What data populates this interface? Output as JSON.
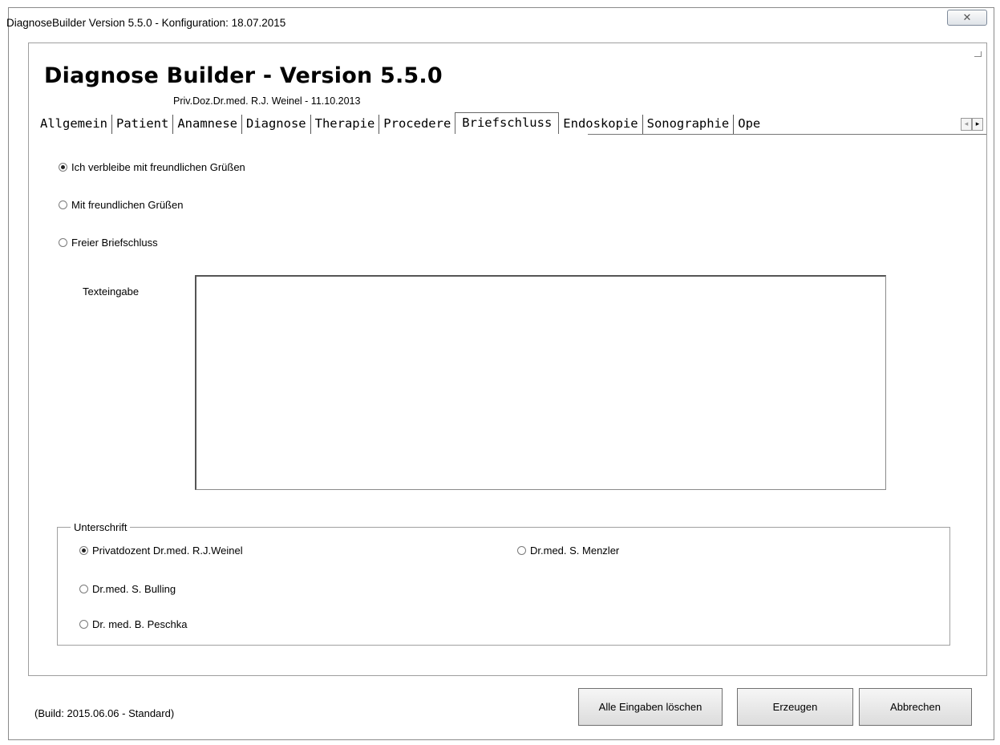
{
  "window": {
    "title": "DiagnoseBuilder Version 5.5.0 - Konfiguration: 18.07.2015",
    "close_glyph": "✕"
  },
  "header": {
    "title": "Diagnose Builder - Version 5.5.0",
    "subtitle": "Priv.Doz.Dr.med. R.J. Weinel - 11.10.2013"
  },
  "tabs": [
    {
      "label": "Allgemein",
      "active": false
    },
    {
      "label": "Patient",
      "active": false
    },
    {
      "label": "Anamnese",
      "active": false
    },
    {
      "label": "Diagnose",
      "active": false
    },
    {
      "label": "Therapie",
      "active": false
    },
    {
      "label": "Procedere",
      "active": false
    },
    {
      "label": "Briefschluss",
      "active": true
    },
    {
      "label": "Endoskopie",
      "active": false
    },
    {
      "label": "Sonographie",
      "active": false
    },
    {
      "label": "Ope",
      "active": false
    }
  ],
  "tab_scroll": {
    "left": "◂",
    "right": "▸"
  },
  "closing": {
    "options": [
      {
        "label": "Ich verbleibe mit freundlichen Grüßen",
        "selected": true
      },
      {
        "label": "Mit freundlichen Grüßen",
        "selected": false
      },
      {
        "label": "Freier Briefschluss",
        "selected": false
      }
    ],
    "text_label": "Texteingabe",
    "text_value": ""
  },
  "signature": {
    "legend": "Unterschrift",
    "options": [
      {
        "label": "Privatdozent Dr.med. R.J.Weinel",
        "selected": true
      },
      {
        "label": "Dr.med. S. Menzler",
        "selected": false
      },
      {
        "label": "Dr.med. S. Bulling",
        "selected": false
      },
      {
        "label": "Dr. med. B. Peschka",
        "selected": false
      }
    ]
  },
  "footer": {
    "build": "(Build: 2015.06.06 - Standard)",
    "clear_label": "Alle Eingaben löschen",
    "generate_label": "Erzeugen",
    "cancel_label": "Abbrechen"
  }
}
